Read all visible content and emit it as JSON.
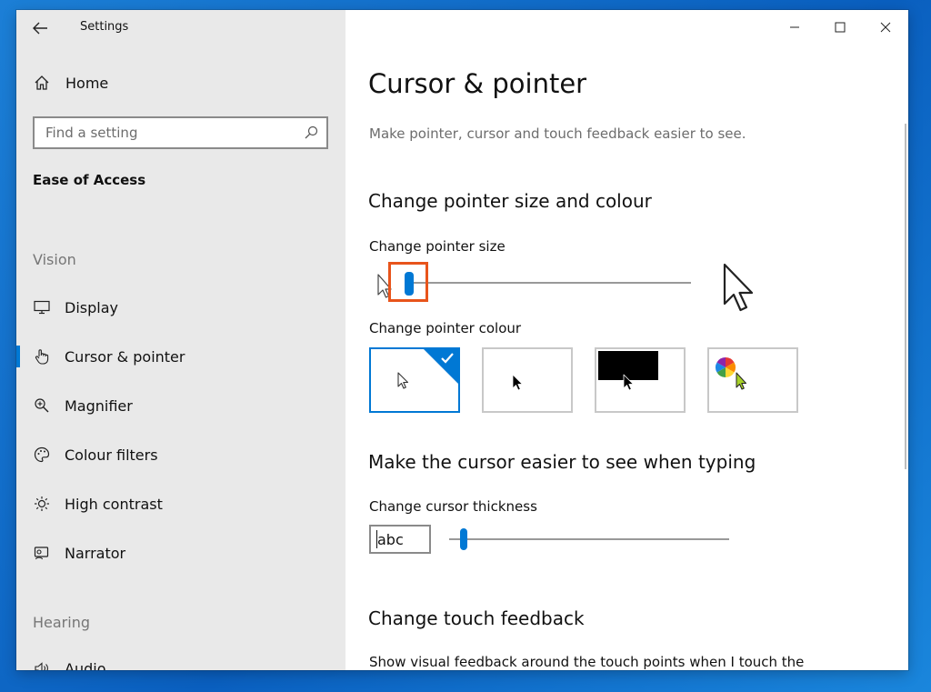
{
  "window": {
    "app_title": "Settings"
  },
  "sidebar": {
    "home_label": "Home",
    "search_placeholder": "Find a setting",
    "section_title": "Ease of Access",
    "vision_label": "Vision",
    "items": [
      {
        "label": "Display",
        "icon": "monitor-icon"
      },
      {
        "label": "Cursor & pointer",
        "icon": "hand-pointer-icon"
      },
      {
        "label": "Magnifier",
        "icon": "magnifier-icon"
      },
      {
        "label": "Colour filters",
        "icon": "palette-icon"
      },
      {
        "label": "High contrast",
        "icon": "sun-icon"
      },
      {
        "label": "Narrator",
        "icon": "narrator-icon"
      }
    ],
    "hearing_label": "Hearing",
    "partial_item_label": "Audio",
    "selected_item": "Cursor & pointer"
  },
  "main": {
    "title": "Cursor & pointer",
    "description": "Make pointer, cursor and touch feedback easier to see.",
    "pointer_section": {
      "heading": "Change pointer size and colour",
      "size_label": "Change pointer size",
      "size_level": 1,
      "colour_label": "Change pointer colour",
      "colour_options": [
        {
          "name": "white",
          "selected": true
        },
        {
          "name": "black",
          "selected": false
        },
        {
          "name": "inverted",
          "selected": false
        },
        {
          "name": "custom",
          "selected": false
        }
      ]
    },
    "cursor_section": {
      "heading": "Make the cursor easier to see when typing",
      "thickness_label": "Change cursor thickness",
      "preview_text": "abc",
      "thickness_level": 1
    },
    "touch_section": {
      "heading": "Change touch feedback",
      "description": "Show visual feedback around the touch points when I touch the"
    }
  },
  "colors": {
    "accent": "#0078d4",
    "highlight": "#e8541b",
    "sidebar_bg": "#e9e9e9"
  }
}
